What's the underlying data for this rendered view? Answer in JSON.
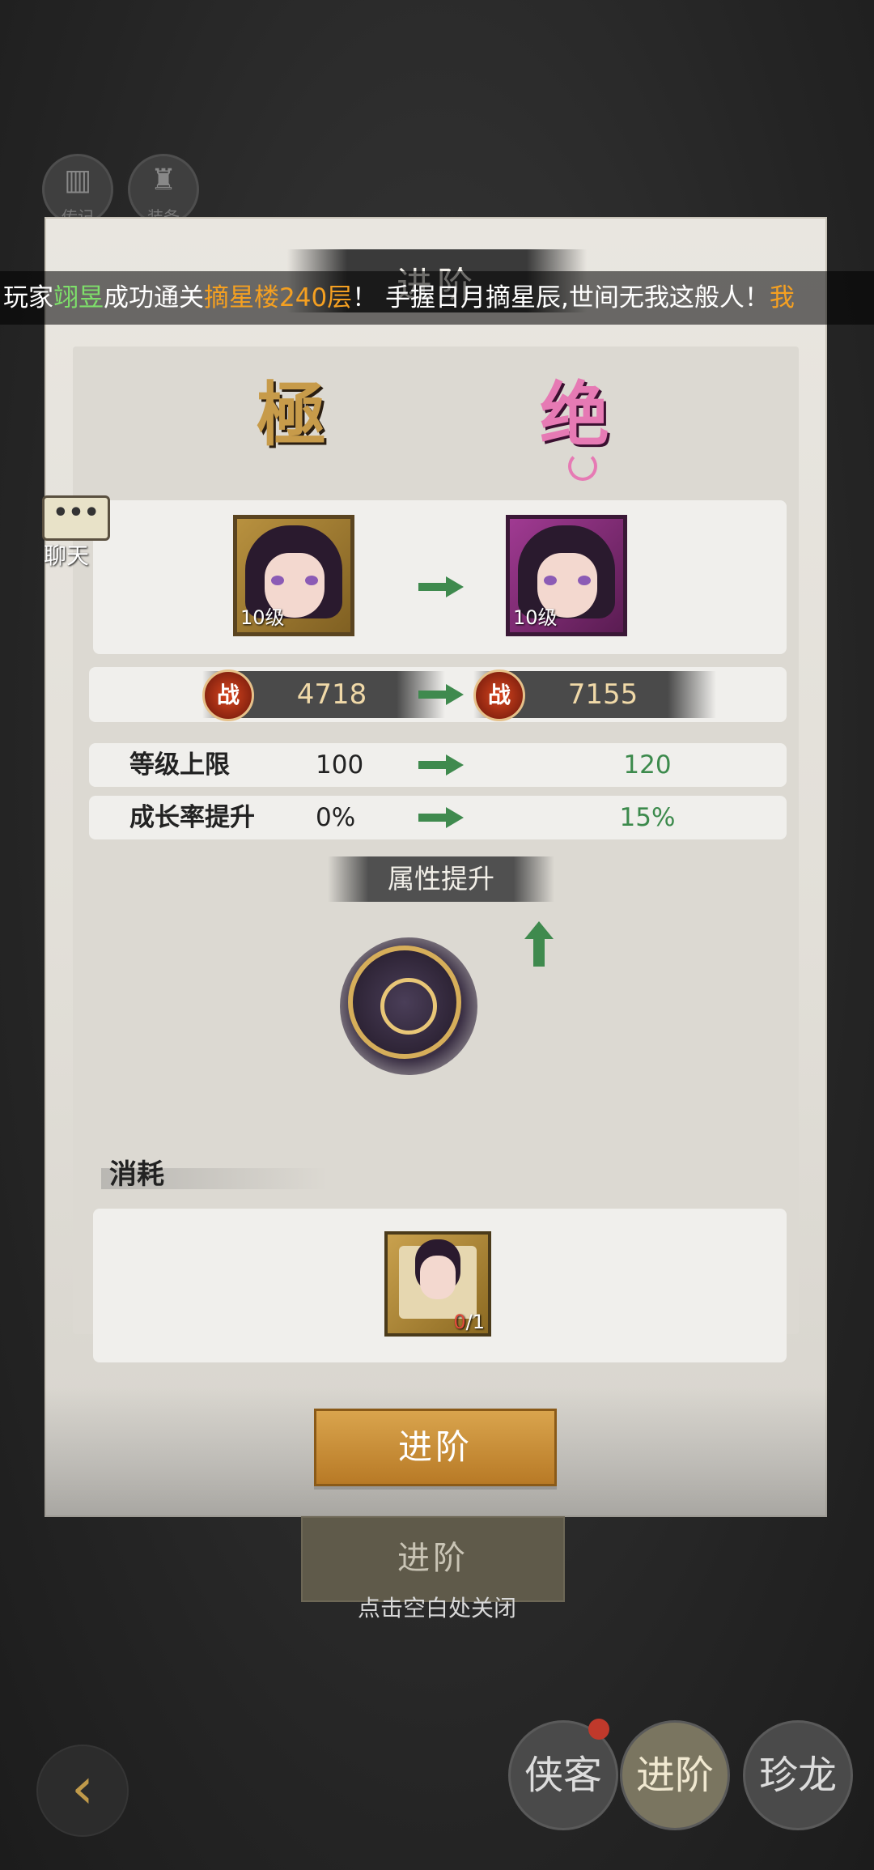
{
  "ticker": {
    "prefix": "玩家",
    "player": "翊昱",
    "middle": "成功通关",
    "achievement": "摘星楼240层",
    "suffix": "！ 手握日月摘星辰,世间无我这般人！",
    "tail": "我"
  },
  "background_nav": {
    "icon1_label": "传记",
    "icon2_label": "装备",
    "chat_dots": "•••",
    "chat_label": "聊天",
    "bg_advance_label": "进阶",
    "close_hint": "点击空白处关闭",
    "back_glyph": "‹",
    "nav_items": [
      {
        "label": "侠客"
      },
      {
        "label": "进阶"
      },
      {
        "label": "珍龙"
      }
    ]
  },
  "dialog": {
    "title": "进阶",
    "tier_from": "極",
    "tier_to": "绝",
    "portrait_from": {
      "level": "10级",
      "frame_color": "#b8913f"
    },
    "portrait_to": {
      "level": "10级",
      "frame_color": "#a03a92"
    },
    "power": {
      "icon": "战",
      "from": "4718",
      "to": "7155"
    },
    "stats": [
      {
        "label": "等级上限",
        "from": "100",
        "to": "120"
      },
      {
        "label": "成长率提升",
        "from": "0%",
        "to": "15%"
      }
    ],
    "attr_header": "属性提升",
    "consume_title": "消耗",
    "consume_item": {
      "have": "0",
      "need": "/1"
    },
    "advance_button": "进阶"
  },
  "colors": {
    "accent_gold": "#d9a44d",
    "increase_green": "#3c8a4c",
    "highlight_orange": "#f5a021",
    "highlight_green": "#7ee06a"
  }
}
